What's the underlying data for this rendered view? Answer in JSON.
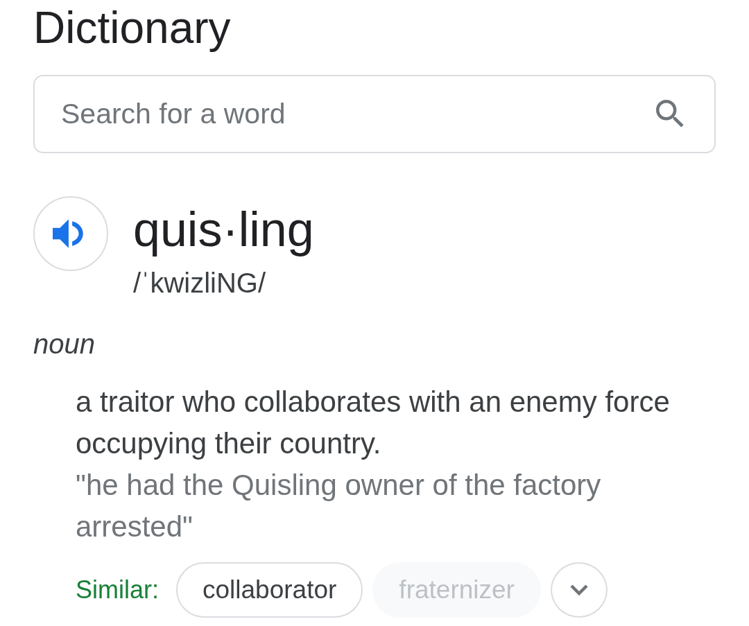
{
  "title": "Dictionary",
  "search": {
    "placeholder": "Search for a word"
  },
  "entry": {
    "word": "quis·ling",
    "phonetic": "/ˈkwizliNG/",
    "part_of_speech": "noun",
    "definitions": [
      {
        "text": "a traitor who collaborates with an enemy force occupying their country.",
        "example": "\"he had the Quisling owner of the factory arrested\"",
        "similar_label": "Similar:",
        "similar": [
          {
            "label": "collaborator",
            "faded": false
          },
          {
            "label": "fraternizer",
            "faded": true
          }
        ]
      }
    ]
  }
}
